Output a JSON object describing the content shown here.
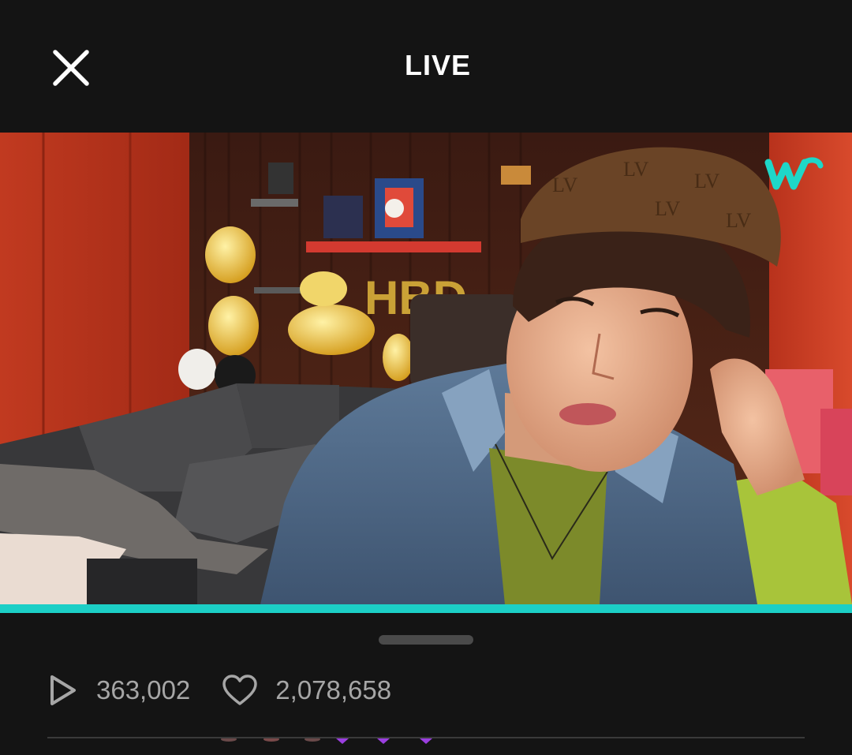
{
  "header": {
    "title": "LIVE",
    "close_icon": "close-icon"
  },
  "video": {
    "watermark_icon": "weverse-logo-icon",
    "progress": 1.0,
    "accent_color": "#1ccfc6"
  },
  "stats": {
    "plays": {
      "icon": "play-icon",
      "value": "363,002"
    },
    "likes": {
      "icon": "heart-icon",
      "value": "2,078,658"
    }
  }
}
